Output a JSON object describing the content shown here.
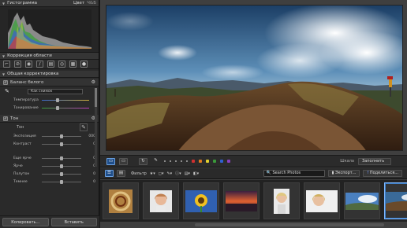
{
  "histogram": {
    "title": "Гистограмма",
    "mode_color": "Цвет",
    "mode_bw": "Ч&Б"
  },
  "region_correction": {
    "title": "Коррекция области"
  },
  "general_correction": {
    "title": "Общая корректировка"
  },
  "white_balance": {
    "title": "Баланс белого",
    "preset": "Как снимок",
    "temperature_label": "Температура",
    "tint_label": "Тонирование"
  },
  "tone": {
    "title": "Тон",
    "tone_label": "Тон",
    "exposure_label": "Экспозиция",
    "exposure_value": "000",
    "contrast_label": "Контраст",
    "contrast_value": "0",
    "brighter_label": "Еще ярче",
    "brighter_value": "0",
    "bright_label": "Ярче",
    "bright_value": "0",
    "midtones_label": "Полутон",
    "midtones_value": "0",
    "darker_label": "Темнее",
    "darker_value": "0"
  },
  "bottom_buttons": {
    "copy": "Копировать...",
    "paste": "Вставить"
  },
  "viewer_toolbar": {
    "scale_label": "Шкала",
    "scale_value": "Заполнить",
    "color_labels": [
      "#d03030",
      "#e07a20",
      "#e0d030",
      "#3a9a3a",
      "#3060d0",
      "#8a3fc0"
    ]
  },
  "browser_toolbar": {
    "filter_label": "Фильтр",
    "search_placeholder": "Search Photos",
    "export_label": "Экспорт...",
    "share_label": "Поделиться..."
  },
  "thumbnails": [
    {
      "name": "spiral-shell"
    },
    {
      "name": "woman-portrait"
    },
    {
      "name": "sunflower"
    },
    {
      "name": "sunset-lake"
    },
    {
      "name": "woman-portrait-2"
    },
    {
      "name": "woman-portrait-3"
    },
    {
      "name": "panorama-sky"
    },
    {
      "name": "panorama-mountain"
    }
  ]
}
